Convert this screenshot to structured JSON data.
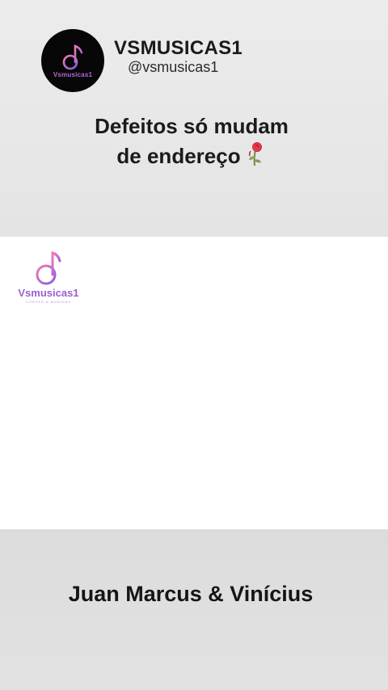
{
  "header": {
    "avatar_text": "Vsmusicas1",
    "channel_name": "VSMUSICAS1",
    "handle": "@vsmusicas1"
  },
  "title": {
    "line1": "Defeitos só mudam",
    "line2": "de endereço",
    "emoji_icon": "wilted-rose-icon"
  },
  "watermark": {
    "brand": "Vsmusicas1",
    "tagline": "CORTES & MÚSICAS"
  },
  "footer": {
    "artist": "Juan Marcus & Vinícius"
  },
  "colors": {
    "accent_purple": "#9a5fd0",
    "accent_pink": "#e06bb0",
    "background_gray": "#e3e3e3"
  }
}
